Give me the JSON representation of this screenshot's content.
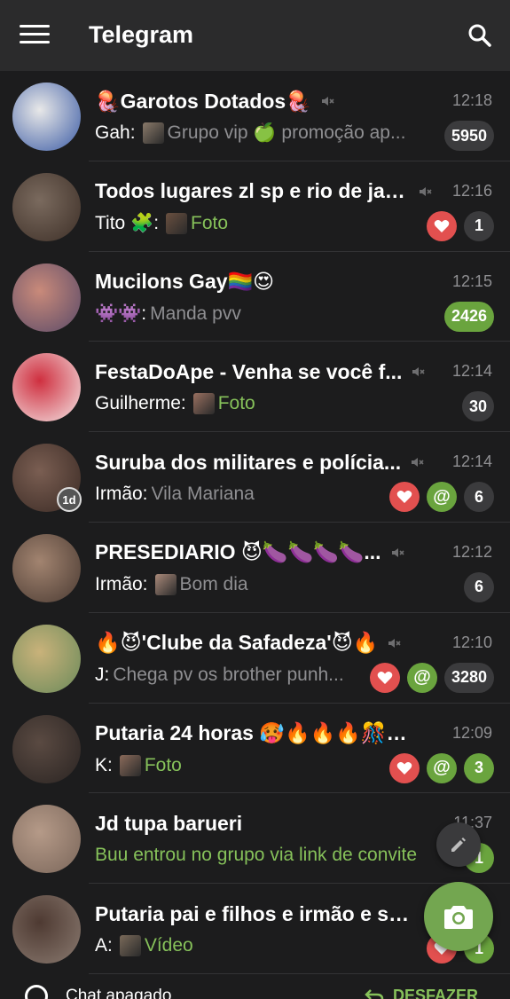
{
  "header": {
    "title": "Telegram",
    "menu_icon": "menu-icon",
    "search_icon": "search-icon"
  },
  "chats": [
    {
      "title": "🪼Garotos Dotados🪼",
      "muted": true,
      "time": "12:18",
      "sender": "Gah:",
      "message": "Grupo vip 🍏 promoção ap...",
      "message_style": "grey",
      "thumb": true,
      "badges": [
        {
          "type": "count",
          "value": "5950",
          "color": "grey"
        }
      ]
    },
    {
      "title": "Todos lugares zl sp e rio de jan...",
      "muted": true,
      "time": "12:16",
      "sender": "Tito 🧩:",
      "message": "Foto",
      "message_style": "green",
      "thumb": true,
      "badges": [
        {
          "type": "reaction"
        },
        {
          "type": "count",
          "value": "1",
          "color": "grey"
        }
      ]
    },
    {
      "title": "Mucilons Gay🏳️‍🌈😍",
      "muted": false,
      "time": "12:15",
      "sender": "👾👾:",
      "message": "Manda pvv",
      "message_style": "grey",
      "thumb": false,
      "badges": [
        {
          "type": "count",
          "value": "2426",
          "color": "green"
        }
      ]
    },
    {
      "title": "FestaDoApe - Venha se você f...",
      "muted": true,
      "time": "12:14",
      "sender": "Guilherme:",
      "message": "Foto",
      "message_style": "green",
      "thumb": true,
      "badges": [
        {
          "type": "count",
          "value": "30",
          "color": "grey"
        }
      ]
    },
    {
      "title": "Suruba dos militares e polícia...",
      "muted": true,
      "time": "12:14",
      "sender": "Irmão:",
      "message": "Vila Mariana",
      "message_style": "grey",
      "thumb": false,
      "avatar_badge": "1d",
      "badges": [
        {
          "type": "reaction"
        },
        {
          "type": "mention"
        },
        {
          "type": "count",
          "value": "6",
          "color": "grey"
        }
      ]
    },
    {
      "title": "PRESEDIARIO 😈🍆🍆🍆🍆...",
      "muted": true,
      "time": "12:12",
      "sender": "Irmão:",
      "message": "Bom dia",
      "message_style": "grey",
      "thumb": true,
      "badges": [
        {
          "type": "count",
          "value": "6",
          "color": "grey"
        }
      ]
    },
    {
      "title": "🔥😈'Clube da Safadeza'😈🔥",
      "muted": true,
      "time": "12:10",
      "sender": "J:",
      "message": "Chega pv os brother punh...",
      "message_style": "grey",
      "thumb": false,
      "badges": [
        {
          "type": "reaction"
        },
        {
          "type": "mention"
        },
        {
          "type": "count",
          "value": "3280",
          "color": "grey"
        }
      ]
    },
    {
      "title": "Putaria 24 horas 🥵🔥🔥🔥🎊🎊",
      "muted": false,
      "time": "12:09",
      "sender": "K:",
      "message": "Foto",
      "message_style": "green",
      "thumb": true,
      "badges": [
        {
          "type": "reaction"
        },
        {
          "type": "mention"
        },
        {
          "type": "count",
          "value": "3",
          "color": "green"
        }
      ]
    },
    {
      "title": "Jd tupa barueri",
      "muted": false,
      "time": "11:37",
      "sender": "",
      "message": "Buu entrou no grupo via link de convite",
      "message_style": "green",
      "thumb": false,
      "badges": [
        {
          "type": "count",
          "value": "1",
          "color": "green"
        }
      ]
    },
    {
      "title": "Putaria pai e filhos e irmão e sob...",
      "muted": false,
      "time": "",
      "sender": "A:",
      "message": "Vídeo",
      "message_style": "green",
      "thumb": true,
      "badges": [
        {
          "type": "reaction"
        },
        {
          "type": "count",
          "value": "1",
          "color": "green"
        }
      ]
    }
  ],
  "fab": {
    "pencil_icon": "pencil-icon",
    "camera_icon": "camera-icon"
  },
  "snackbar": {
    "text": "Chat apagado",
    "action": "DESFAZER"
  },
  "colors": {
    "accent_green": "#6aa43e",
    "header_bg": "#2b2b2c",
    "bg": "#1c1c1d",
    "reaction_red": "#e2504f"
  }
}
